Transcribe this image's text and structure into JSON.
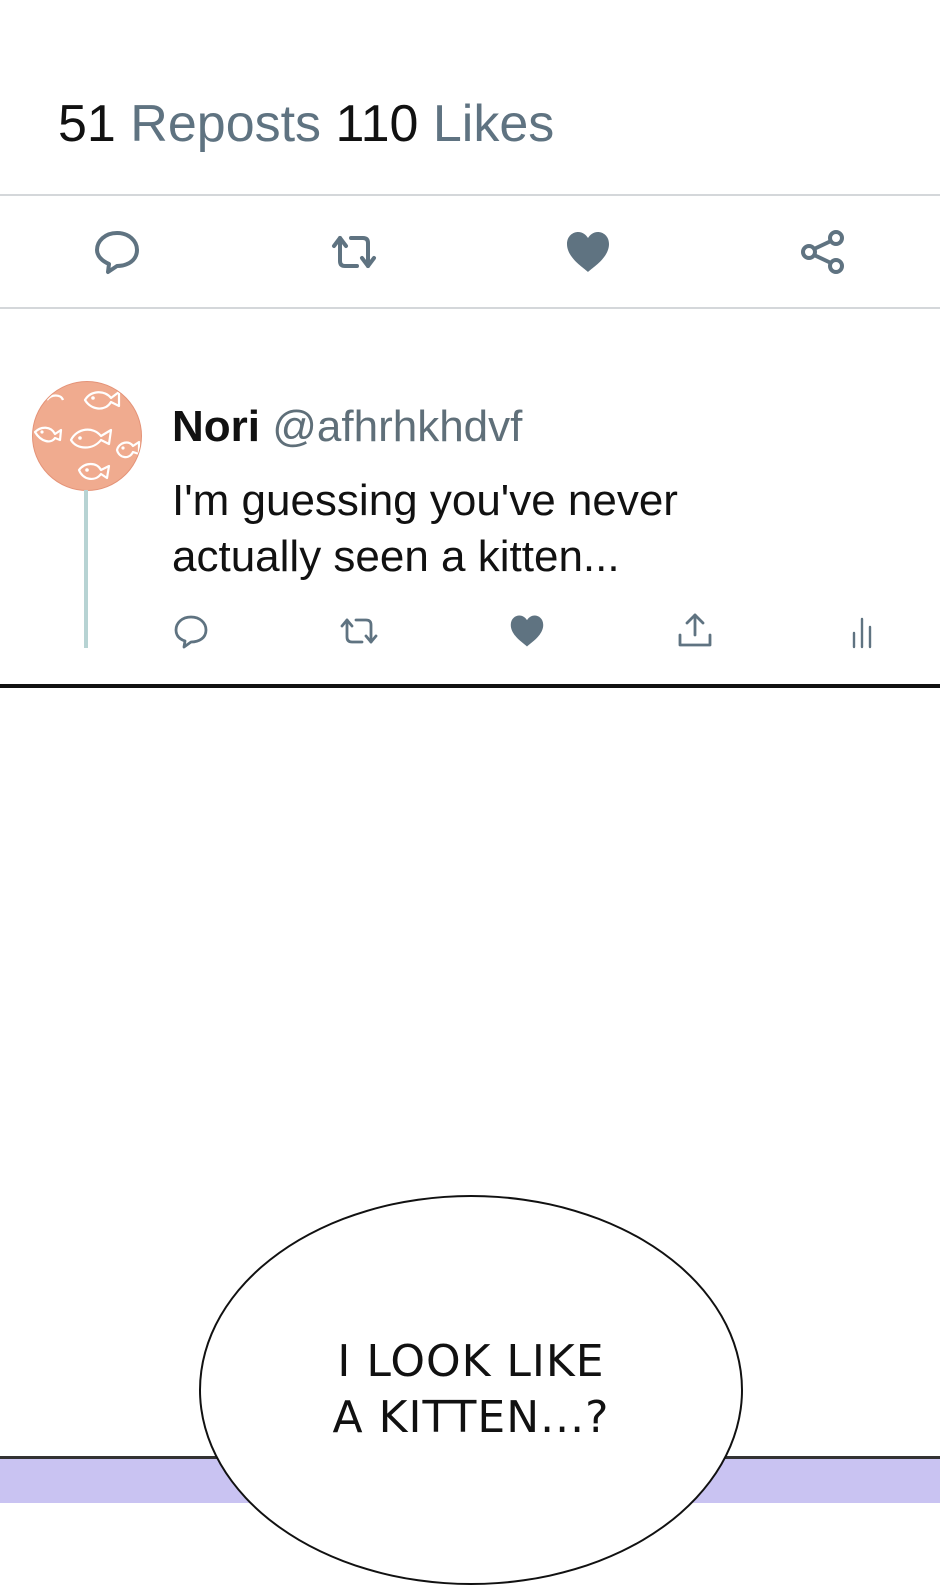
{
  "stats": {
    "reposts_count": "51",
    "reposts_label": "Reposts",
    "likes_count": "110",
    "likes_label": "Likes"
  },
  "main_actions": [
    "reply-icon",
    "repost-icon",
    "like-icon",
    "share-icon"
  ],
  "reply": {
    "avatar": "fish-pattern-avatar",
    "name": "Nori",
    "handle": "@afhrhkhdvf",
    "text": "I'm guessing you've never actually seen a kitten...",
    "actions": [
      "reply-icon",
      "repost-icon",
      "like-icon",
      "upload-icon",
      "analytics-icon"
    ]
  },
  "speech_bubble": {
    "line1": "I LOOK LIKE",
    "line2": "A KITTEN...?"
  },
  "colors": {
    "icon": "#5f7381",
    "label": "#5f7381",
    "avatar_bg": "#f0ab8f",
    "thread": "#b7d3d3",
    "comic_purple": "#c9c3f2"
  }
}
